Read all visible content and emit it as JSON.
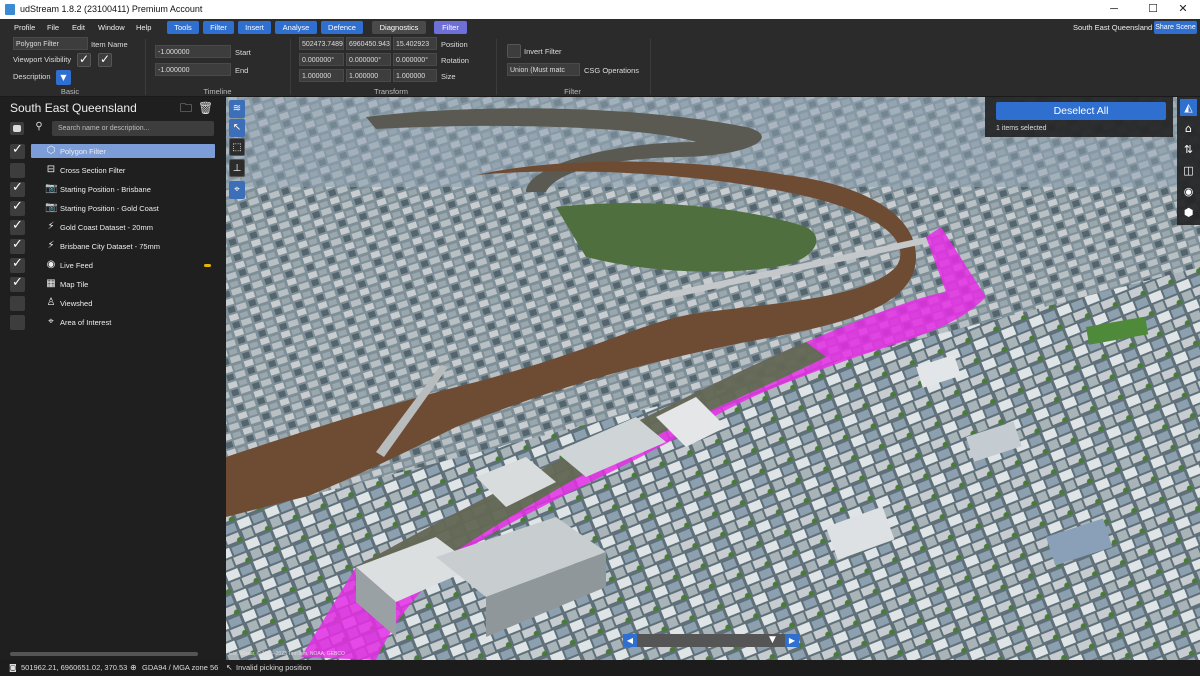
{
  "window": {
    "title": "udStream 1.8.2 (23100411) Premium Account",
    "minimize": "─",
    "maximize": "☐",
    "close": "✕"
  },
  "menu": {
    "items": [
      "Profile",
      "File",
      "Edit",
      "Window",
      "Help"
    ],
    "tools": "Tools",
    "filter": "Filter",
    "insert": "Insert",
    "analyse": "Analyse",
    "defence": "Defence",
    "diagnostics": "Diagnostics",
    "filter_tab": "Filter",
    "region": "South East Queensland",
    "share": "Share Scene"
  },
  "ribbon": {
    "basic": {
      "item_name_value": "Polygon Filter",
      "item_name_label": "Item Name",
      "viewport_visibility_label": "Viewport Visibility",
      "description_label": "Description",
      "group_label": "Basic"
    },
    "timeline": {
      "start_value": "-1.000000",
      "start_label": "Start",
      "end_value": "-1.000000",
      "end_label": "End",
      "group_label": "Timeline"
    },
    "transform": {
      "position": [
        "502473.74897",
        "6960450.9438",
        "15.402923"
      ],
      "position_label": "Position",
      "rotation": [
        "0.000000°",
        "0.000000°",
        "0.000000°"
      ],
      "rotation_label": "Rotation",
      "size": [
        "1.000000",
        "1.000000",
        "1.000000"
      ],
      "size_label": "Size",
      "group_label": "Transform"
    },
    "filter": {
      "invert_label": "Invert Filter",
      "csg_value": "Union (Must matc",
      "csg_label": "CSG Operations",
      "group_label": "Filter"
    }
  },
  "scene": {
    "title": "South East Queensland",
    "search_placeholder": "Search name or description...",
    "items": [
      {
        "label": "Polygon Filter",
        "icon": "polygon-icon",
        "glyph": "⬡",
        "checked": true,
        "selected": true
      },
      {
        "label": "Cross Section Filter",
        "icon": "cross-section-icon",
        "glyph": "⊟",
        "checked": false,
        "selected": false
      },
      {
        "label": "Starting Position - Brisbane",
        "icon": "camera-icon",
        "glyph": "📷",
        "checked": true,
        "selected": false
      },
      {
        "label": "Starting Position - Gold Coast",
        "icon": "camera-icon",
        "glyph": "📷",
        "checked": true,
        "selected": false
      },
      {
        "label": "Gold Coast Dataset - 20mm",
        "icon": "dataset-icon",
        "glyph": "⚡",
        "checked": true,
        "selected": false
      },
      {
        "label": "Brisbane City Dataset - 75mm",
        "icon": "dataset-icon",
        "glyph": "⚡",
        "checked": true,
        "selected": false
      },
      {
        "label": "Live Feed",
        "icon": "live-feed-icon",
        "glyph": "◉",
        "checked": true,
        "selected": false
      },
      {
        "label": "Map Tile",
        "icon": "map-tile-icon",
        "glyph": "▦",
        "checked": true,
        "selected": false
      },
      {
        "label": "Viewshed",
        "icon": "viewshed-icon",
        "glyph": "♙",
        "checked": false,
        "selected": false
      },
      {
        "label": "Area of Interest",
        "icon": "area-of-interest-icon",
        "glyph": "⌖",
        "checked": false,
        "selected": false
      }
    ]
  },
  "viewport": {
    "deselect_label": "Deselect All",
    "selected_count": "1 items selected",
    "copyright": "Esri, Maxar, © 1995–2023 TomTom, NOAA, GEBCO"
  },
  "status": {
    "coordinates": "501962.21, 6960651.02, 370.53",
    "crs": "GDA94 / MGA zone 56",
    "picking": "Invalid picking position"
  }
}
